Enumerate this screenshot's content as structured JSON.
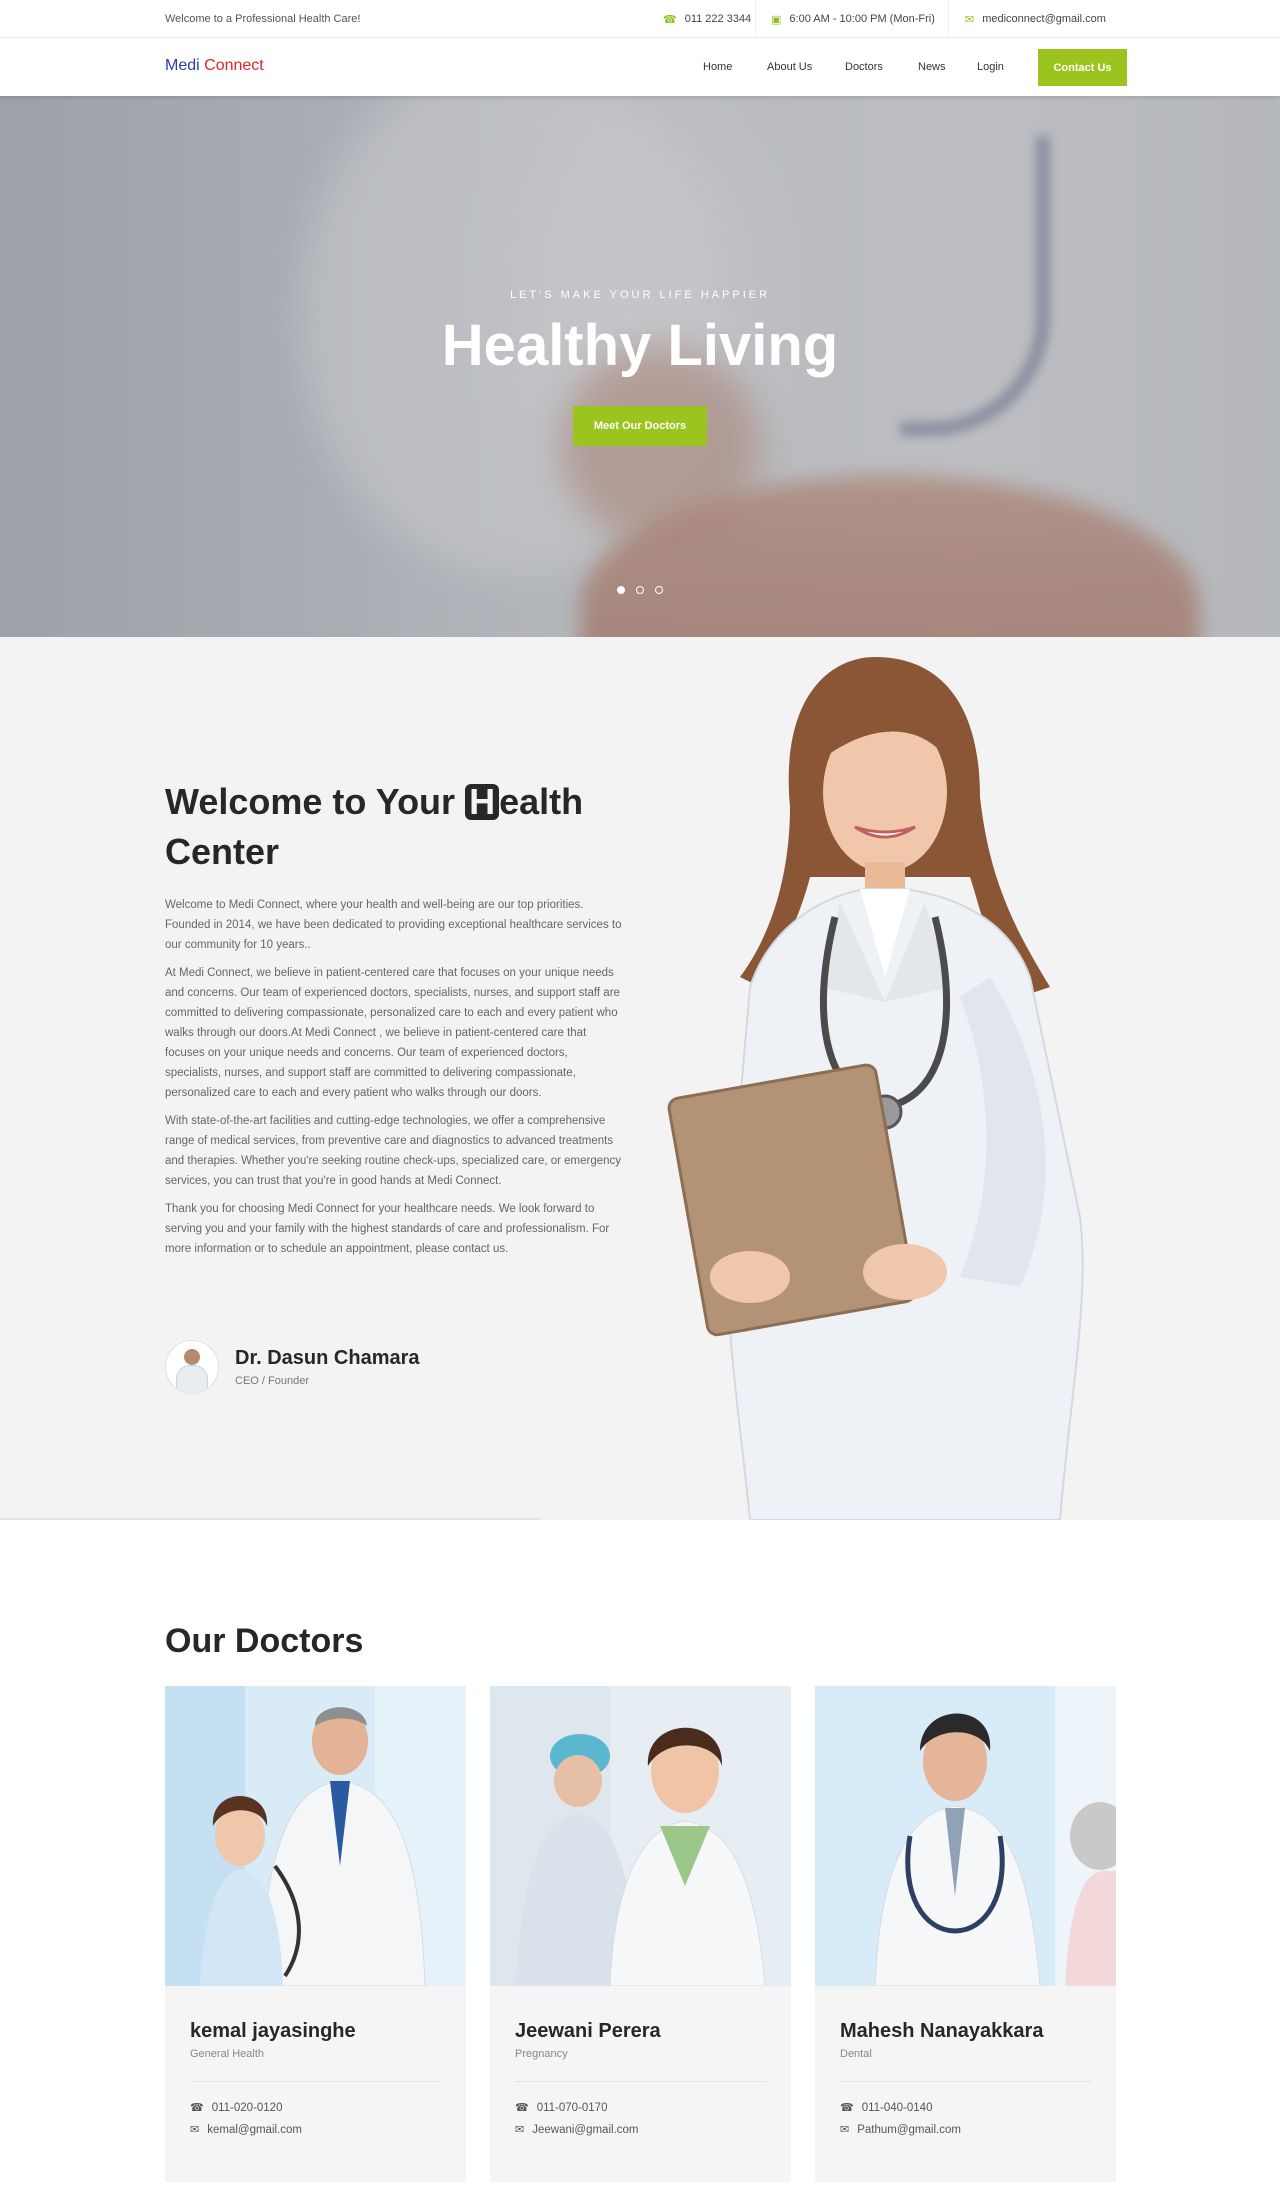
{
  "topbar": {
    "welcome": "Welcome to a Professional Health Care!",
    "phone": "011 222 3344",
    "hours": "6:00 AM - 10:00 PM (Mon-Fri)",
    "email": "mediconnect@gmail.com"
  },
  "nav": {
    "logo_part1": "Medi",
    "logo_part2": "Connect",
    "items": [
      "Home",
      "About Us",
      "Doctors",
      "News",
      "Login"
    ],
    "cta": "Contact Us"
  },
  "hero": {
    "kicker": "LET'S MAKE YOUR LIFE HAPPIER",
    "title": "Healthy Living",
    "button": "Meet Our Doctors",
    "slides": 3,
    "active_slide": 1
  },
  "welcome": {
    "title_part1": "Welcome to Your ",
    "title_highlight": "H",
    "title_part2": "ealth Center",
    "paragraphs": [
      "Welcome to Medi Connect, where your health and well-being are our top priorities. Founded in 2014, we have been dedicated to providing exceptional healthcare services to our community for 10 years..",
      "At Medi Connect, we believe in patient-centered care that focuses on your unique needs and concerns. Our team of experienced doctors, specialists, nurses, and support staff are committed to delivering compassionate, personalized care to each and every patient who walks through our doors.At Medi Connect , we believe in patient-centered care that focuses on your unique needs and concerns. Our team of experienced doctors, specialists, nurses, and support staff are committed to delivering compassionate, personalized care to each and every patient who walks through our doors.",
      "With state-of-the-art facilities and cutting-edge technologies, we offer a comprehensive range of medical services, from preventive care and diagnostics to advanced treatments and therapies. Whether you're seeking routine check-ups, specialized care, or emergency services, you can trust that you're in good hands at Medi Connect.",
      "Thank you for choosing Medi Connect for your healthcare needs. We look forward to serving you and your family with the highest standards of care and professionalism. For more information or to schedule an appointment, please contact us."
    ],
    "founder_name": "Dr. Dasun Chamara",
    "founder_role": "CEO / Founder"
  },
  "doctors": {
    "title": "Our Doctors",
    "cards": [
      {
        "name": "kemal jayasinghe",
        "specialty": "General Health",
        "phone": "011-020-0120",
        "email": "kemal@gmail.com"
      },
      {
        "name": "Jeewani Perera",
        "specialty": "Pregnancy",
        "phone": "011-070-0170",
        "email": "Jeewani@gmail.com"
      },
      {
        "name": "Mahesh Nanayakkara",
        "specialty": "Dental",
        "phone": "011-040-0140",
        "email": "Pathum@gmail.com"
      }
    ]
  },
  "colors": {
    "accent": "#9cc41e",
    "logo_blue": "#2b3aa6",
    "logo_red": "#e0242c",
    "heading": "#272727"
  }
}
